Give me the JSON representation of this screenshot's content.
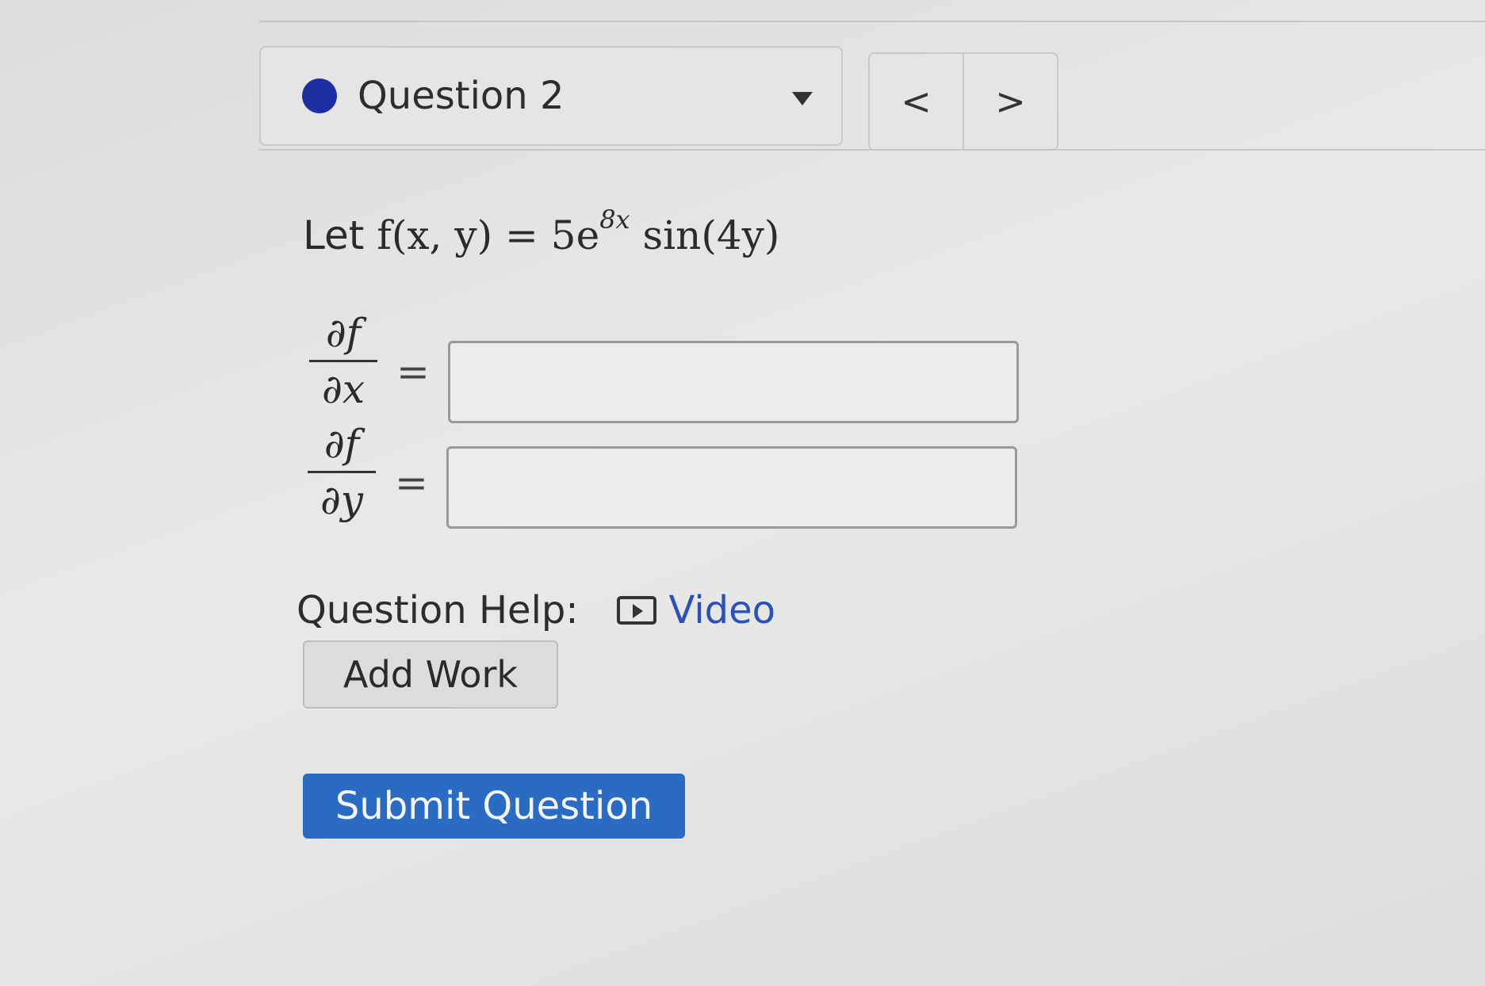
{
  "question_selector": {
    "label": "Question 2",
    "status_color": "#1e2fa3"
  },
  "navigation": {
    "prev_label": "<",
    "next_label": ">"
  },
  "problem": {
    "let_label": "Let",
    "lhs": "f(x, y) = 5e",
    "exponent": "8x",
    "rhs": " sin(4y)"
  },
  "partials": [
    {
      "numerator": "∂f",
      "denominator": "∂x",
      "equals": "=",
      "value": ""
    },
    {
      "numerator": "∂f",
      "denominator": "∂y",
      "equals": "=",
      "value": ""
    }
  ],
  "help": {
    "label": "Question Help:",
    "video_label": "Video"
  },
  "buttons": {
    "add_work": "Add Work",
    "submit": "Submit Question"
  },
  "colors": {
    "submit_bg": "#2a6bc4",
    "link": "#2b50b8"
  }
}
